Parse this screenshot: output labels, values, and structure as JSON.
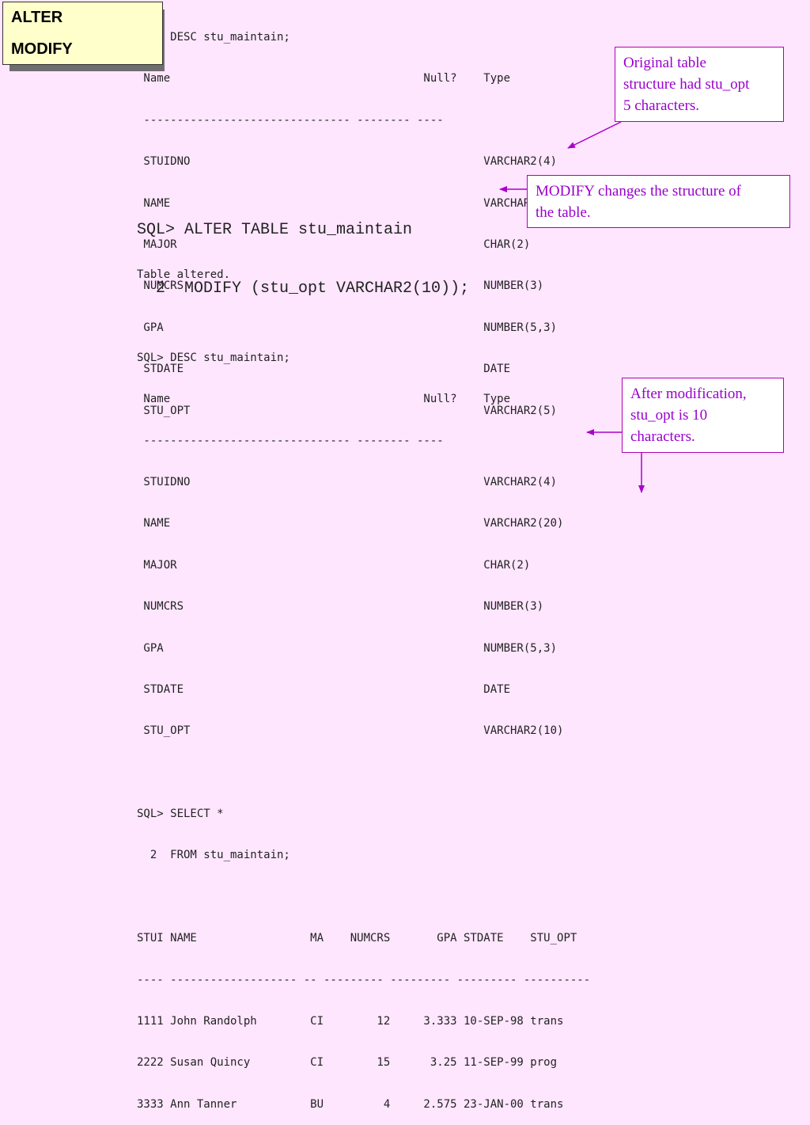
{
  "title": {
    "line1": "ALTER",
    "line2": "MODIFY"
  },
  "desc1": [
    "SQL> DESC stu_maintain;",
    " Name                                      Null?    Type",
    " ------------------------------- -------- ----",
    " STUIDNO                                            VARCHAR2(4)",
    " NAME                                               VARCHAR2(20)",
    " MAJOR                                              CHAR(2)",
    " NUMCRS                                             NUMBER(3)",
    " GPA                                                NUMBER(5,3)",
    " STDATE                                             DATE",
    " STU_OPT                                            VARCHAR2(5)"
  ],
  "alter_cmd": [
    "SQL> ALTER TABLE stu_maintain",
    "  2  MODIFY (stu_opt VARCHAR2(10));"
  ],
  "after": [
    "Table altered.",
    "",
    "SQL> DESC stu_maintain;",
    " Name                                      Null?    Type",
    " ------------------------------- -------- ----",
    " STUIDNO                                            VARCHAR2(4)",
    " NAME                                               VARCHAR2(20)",
    " MAJOR                                              CHAR(2)",
    " NUMCRS                                             NUMBER(3)",
    " GPA                                                NUMBER(5,3)",
    " STDATE                                             DATE",
    " STU_OPT                                            VARCHAR2(10)",
    "",
    "SQL> SELECT *",
    "  2  FROM stu_maintain;",
    "",
    "STUI NAME                 MA    NUMCRS       GPA STDATE    STU_OPT",
    "---- ------------------- -- --------- --------- --------- ----------",
    "1111 John Randolph        CI        12     3.333 10-SEP-98 trans",
    "2222 Susan Quincy         CI        15      3.25 11-SEP-99 prog",
    "3333 Ann Tanner           BU         4     2.575 23-JAN-00 trans"
  ],
  "notes": {
    "original": [
      "Original table",
      "structure had stu_opt",
      "5 characters."
    ],
    "modify": [
      "MODIFY changes the structure of",
      "the table."
    ],
    "after_mod": [
      "After modification,",
      "stu_opt is 10",
      "characters."
    ]
  },
  "colors": {
    "background": "#ffe6ff",
    "note_text": "#9900cc",
    "arrow": "#aa00cc",
    "title_bg": "#ffffcc"
  }
}
